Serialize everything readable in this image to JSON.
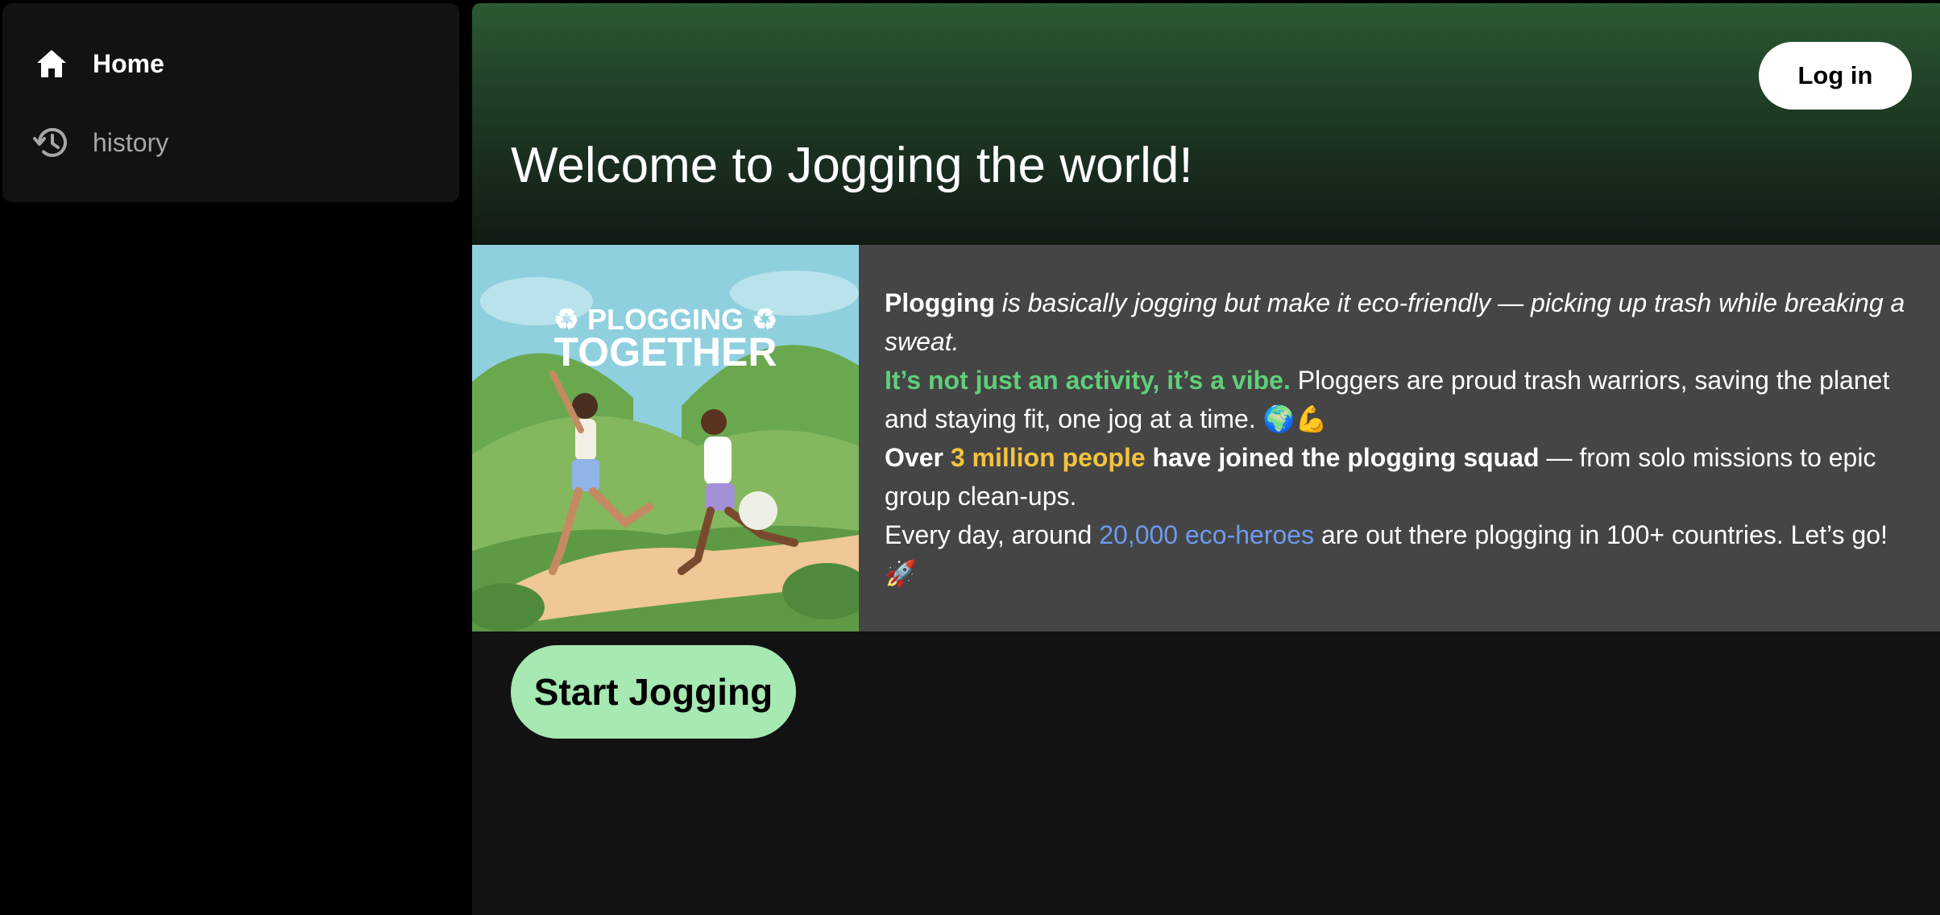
{
  "sidebar": {
    "items": [
      {
        "label": "Home",
        "icon": "home-icon",
        "active": true
      },
      {
        "label": "history",
        "icon": "history-icon",
        "active": false
      }
    ]
  },
  "header": {
    "login_label": "Log in",
    "title": "Welcome to Jogging the world!"
  },
  "card": {
    "image_text_line1": "♻ PLOGGING ♻",
    "image_text_line2": "TOGETHER",
    "p1_bold": "Plogging",
    "p1_italic": " is basically jogging but make it eco-friendly — picking up trash while breaking a sweat.",
    "p2_green": "It’s not just an activity, it’s a vibe.",
    "p2_rest": " Ploggers are proud trash warriors, saving the planet and staying fit, one jog at a time. 🌍💪",
    "p3_over": "Over ",
    "p3_yellow": "3 million people",
    "p3_bold": " have joined the plogging squad",
    "p3_rest": " — from solo missions to epic group clean-ups.",
    "p4_start": "Every day, around ",
    "p4_blue": "20,000 eco-heroes",
    "p4_rest": " are out there plogging in 100+ countries. Let’s go! 🚀"
  },
  "cta": {
    "start_label": "Start Jogging"
  },
  "colors": {
    "accent_green": "#5fcf7a",
    "accent_yellow": "#f4c23c",
    "accent_blue": "#6c9bf0",
    "button_green": "#a6e9b3"
  }
}
